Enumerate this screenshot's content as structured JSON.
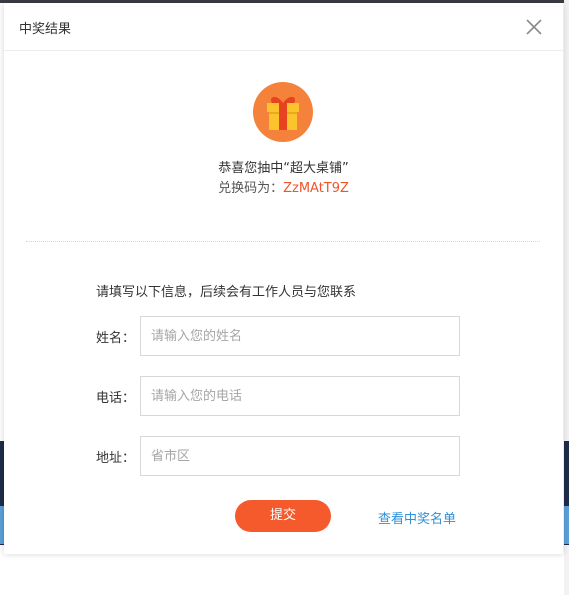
{
  "dialog": {
    "title": "中奖结果",
    "close_icon": "close-icon"
  },
  "prize": {
    "icon": "gift-icon",
    "congrats_text": "恭喜您抽中“超大桌铺”",
    "code_label": "兑换码为：",
    "code_value": "ZzMAtT9Z"
  },
  "form": {
    "instructions": "请填写以下信息，后续会有工作人员与您联系",
    "fields": [
      {
        "label": "姓名：",
        "placeholder": "请输入您的姓名",
        "value": ""
      },
      {
        "label": "电话：",
        "placeholder": "请输入您的电话",
        "value": ""
      },
      {
        "label": "地址：",
        "placeholder": "省市区",
        "value": ""
      }
    ],
    "submit_label": "提交",
    "winners_link": "查看中奖名单"
  },
  "colors": {
    "accent": "#f55a2c",
    "code": "#f0542a",
    "link": "#2f8fd8",
    "gift_circle": "#f5823a",
    "gift_box": "#fcc42c",
    "gift_ribbon": "#e8431f"
  }
}
